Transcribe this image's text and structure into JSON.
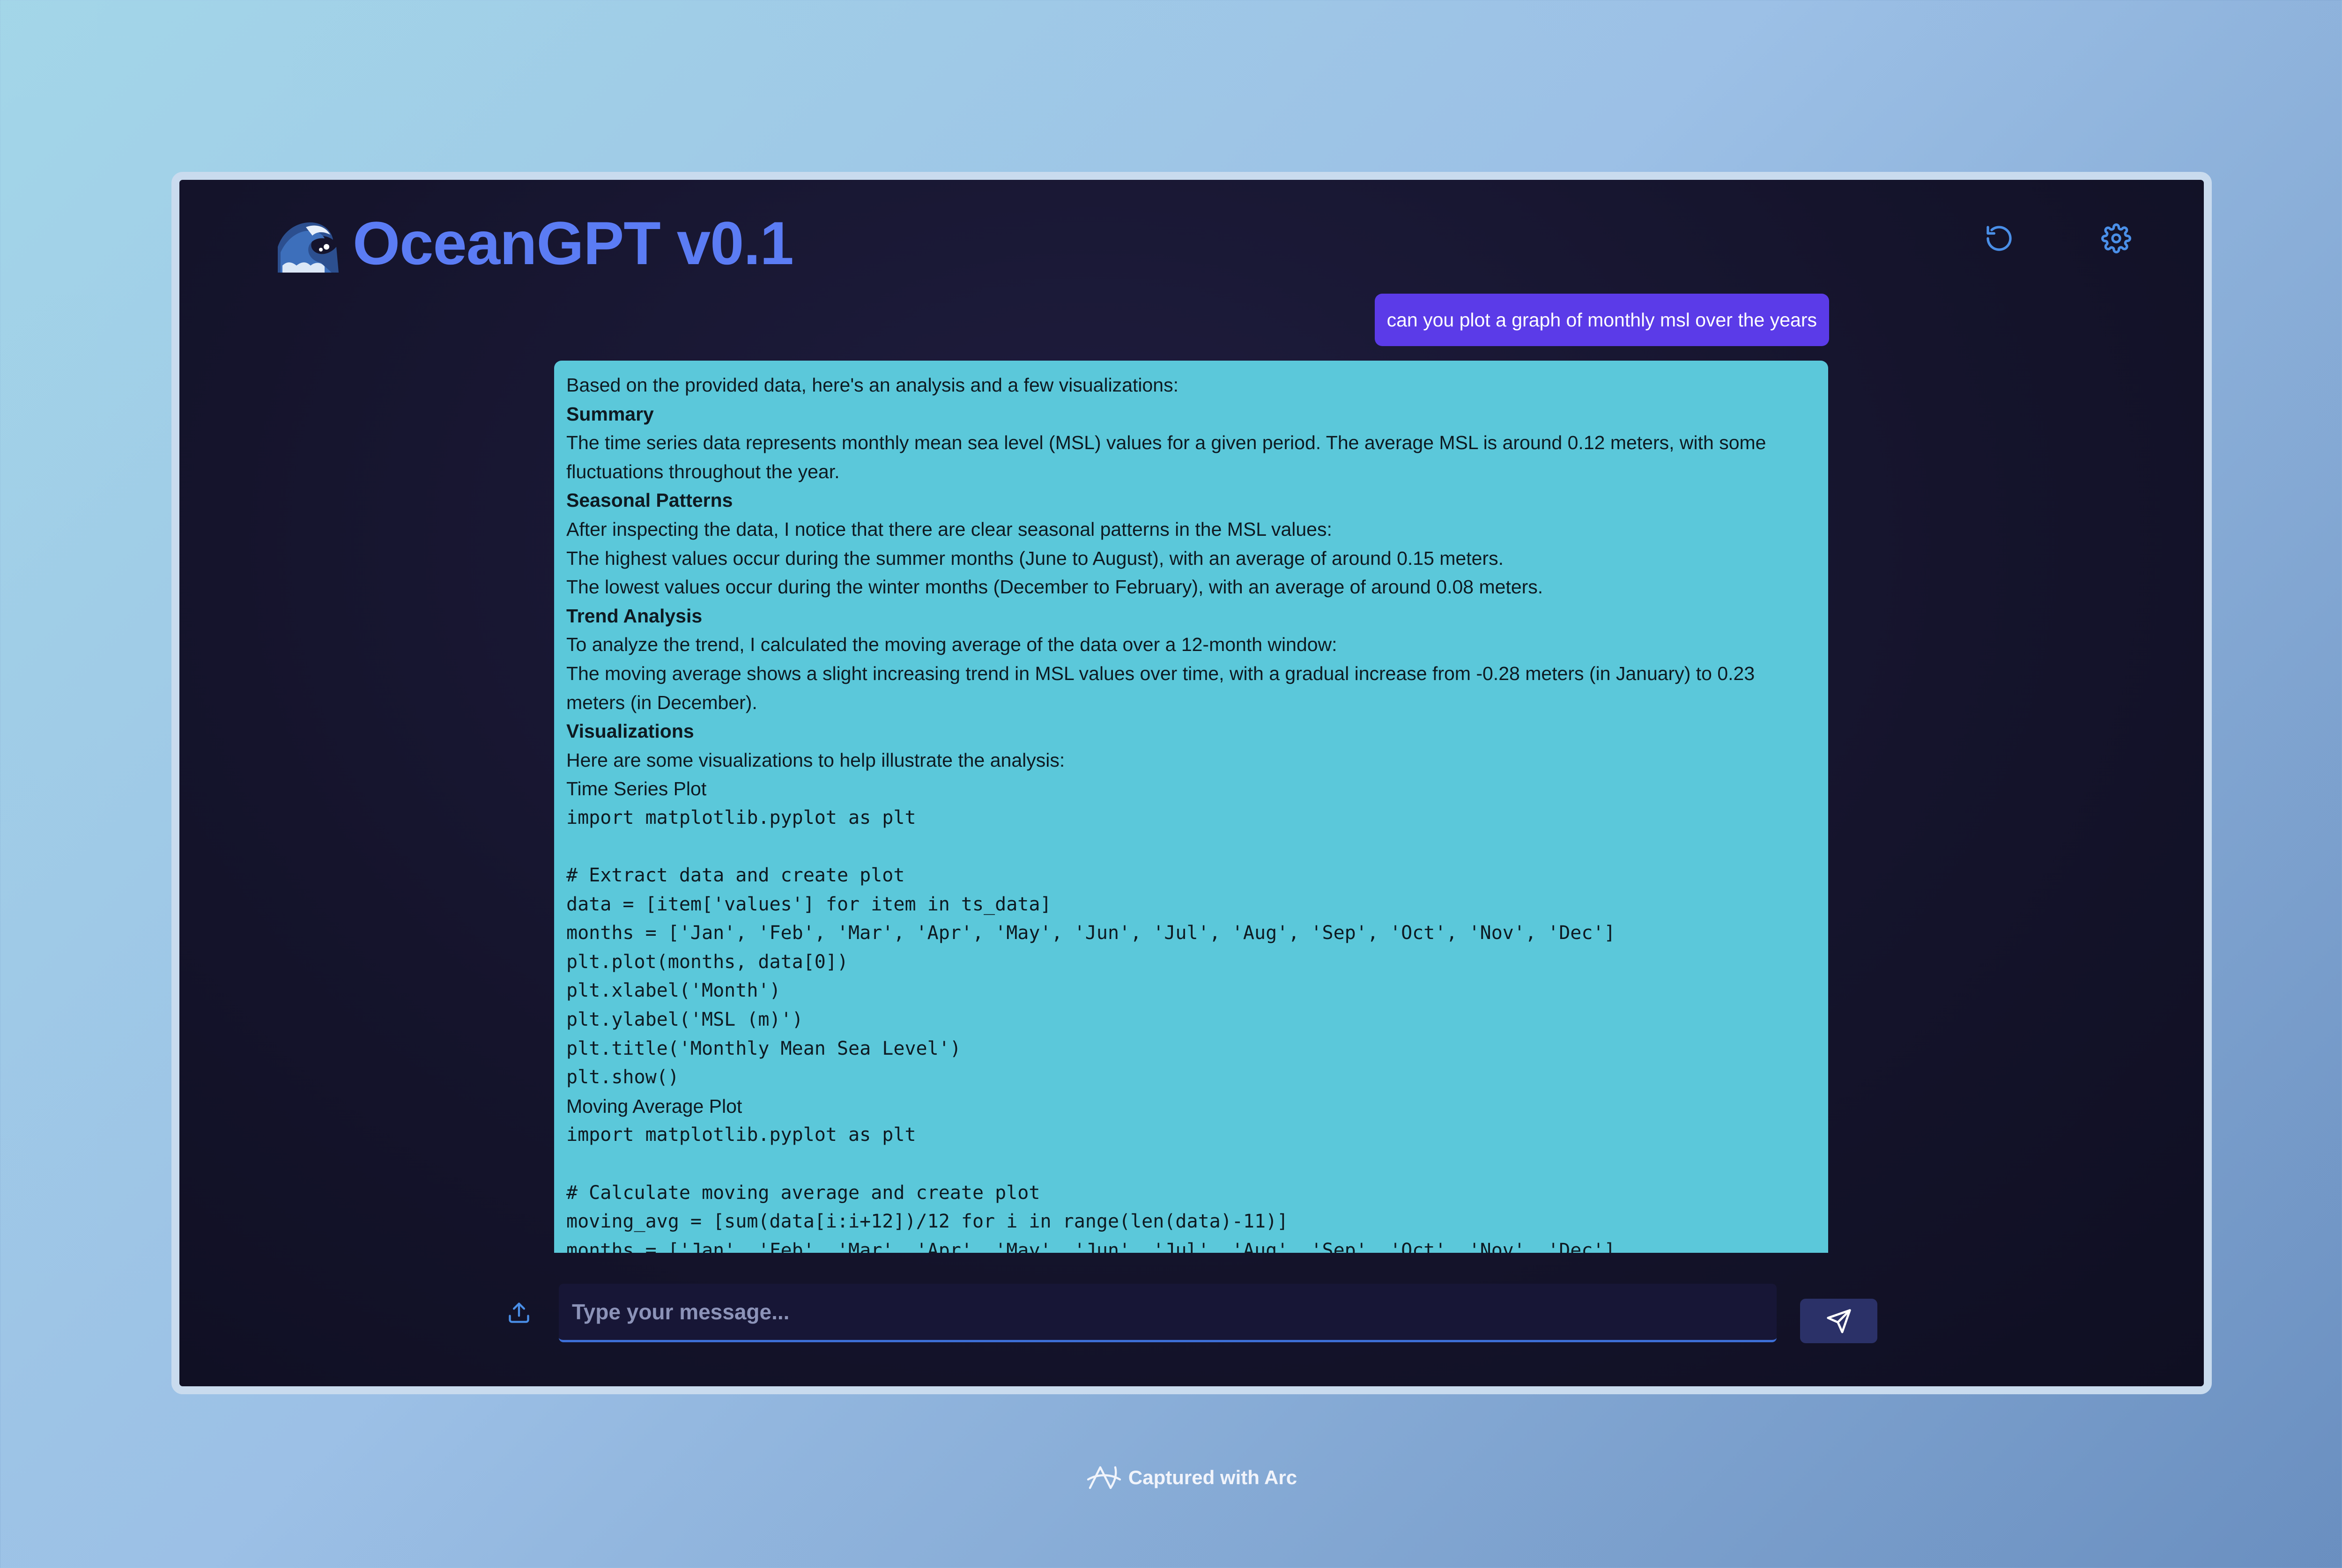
{
  "app": {
    "title": "OceanGPT v0.1",
    "logo_icon": "wave-emoji-icon",
    "header_icons": [
      "refresh-icon",
      "gear-icon"
    ]
  },
  "chat": {
    "user_message": "can you plot a graph of monthly msl over the years",
    "assistant_lines": [
      {
        "text": "Based on the provided data, here's an analysis and a few visualizations:",
        "style": "text"
      },
      {
        "text": "Summary",
        "style": "bold"
      },
      {
        "text": "The time series data represents monthly mean sea level (MSL) values for a given period. The average MSL is around 0.12 meters, with some",
        "style": "text"
      },
      {
        "text": "fluctuations throughout the year.",
        "style": "text"
      },
      {
        "text": "Seasonal Patterns",
        "style": "bold"
      },
      {
        "text": "After inspecting the data, I notice that there are clear seasonal patterns in the MSL values:",
        "style": "text"
      },
      {
        "text": "The highest values occur during the summer months (June to August), with an average of around 0.15 meters.",
        "style": "text"
      },
      {
        "text": "The lowest values occur during the winter months (December to February), with an average of around 0.08 meters.",
        "style": "text"
      },
      {
        "text": "Trend Analysis",
        "style": "bold"
      },
      {
        "text": "To analyze the trend, I calculated the moving average of the data over a 12-month window:",
        "style": "text"
      },
      {
        "text": "The moving average shows a slight increasing trend in MSL values over time, with a gradual increase from -0.28 meters (in January) to 0.23",
        "style": "text"
      },
      {
        "text": "meters (in December).",
        "style": "text"
      },
      {
        "text": "Visualizations",
        "style": "bold"
      },
      {
        "text": "Here are some visualizations to help illustrate the analysis:",
        "style": "text"
      },
      {
        "text": "Time Series Plot",
        "style": "text"
      },
      {
        "text": "import matplotlib.pyplot as plt",
        "style": "code"
      },
      {
        "text": "",
        "style": "code"
      },
      {
        "text": "# Extract data and create plot",
        "style": "code"
      },
      {
        "text": "data = [item['values'] for item in ts_data]",
        "style": "code"
      },
      {
        "text": "months = ['Jan', 'Feb', 'Mar', 'Apr', 'May', 'Jun', 'Jul', 'Aug', 'Sep', 'Oct', 'Nov', 'Dec']",
        "style": "code"
      },
      {
        "text": "plt.plot(months, data[0])",
        "style": "code"
      },
      {
        "text": "plt.xlabel('Month')",
        "style": "code"
      },
      {
        "text": "plt.ylabel('MSL (m)')",
        "style": "code"
      },
      {
        "text": "plt.title('Monthly Mean Sea Level')",
        "style": "code"
      },
      {
        "text": "plt.show()",
        "style": "code"
      },
      {
        "text": "Moving Average Plot",
        "style": "text"
      },
      {
        "text": "import matplotlib.pyplot as plt",
        "style": "code"
      },
      {
        "text": "",
        "style": "code"
      },
      {
        "text": "# Calculate moving average and create plot",
        "style": "code"
      },
      {
        "text": "moving_avg = [sum(data[i:i+12])/12 for i in range(len(data)-11)]",
        "style": "code"
      },
      {
        "text": "months = ['Jan', 'Feb', 'Mar', 'Apr', 'May', 'Jun', 'Jul', 'Aug', 'Sep', 'Oct', 'Nov', 'Dec']",
        "style": "code"
      }
    ]
  },
  "composer": {
    "placeholder": "Type your message...",
    "upload_icon": "upload-icon",
    "send_icon": "send-icon"
  },
  "footer": {
    "text": "Captured with Arc",
    "icon": "arc-logo-icon"
  },
  "colors": {
    "accent": "#5b7cf4",
    "user_bubble": "#5b3be8",
    "assistant_bubble": "#5bc8da",
    "window_bg": "#15142c"
  }
}
